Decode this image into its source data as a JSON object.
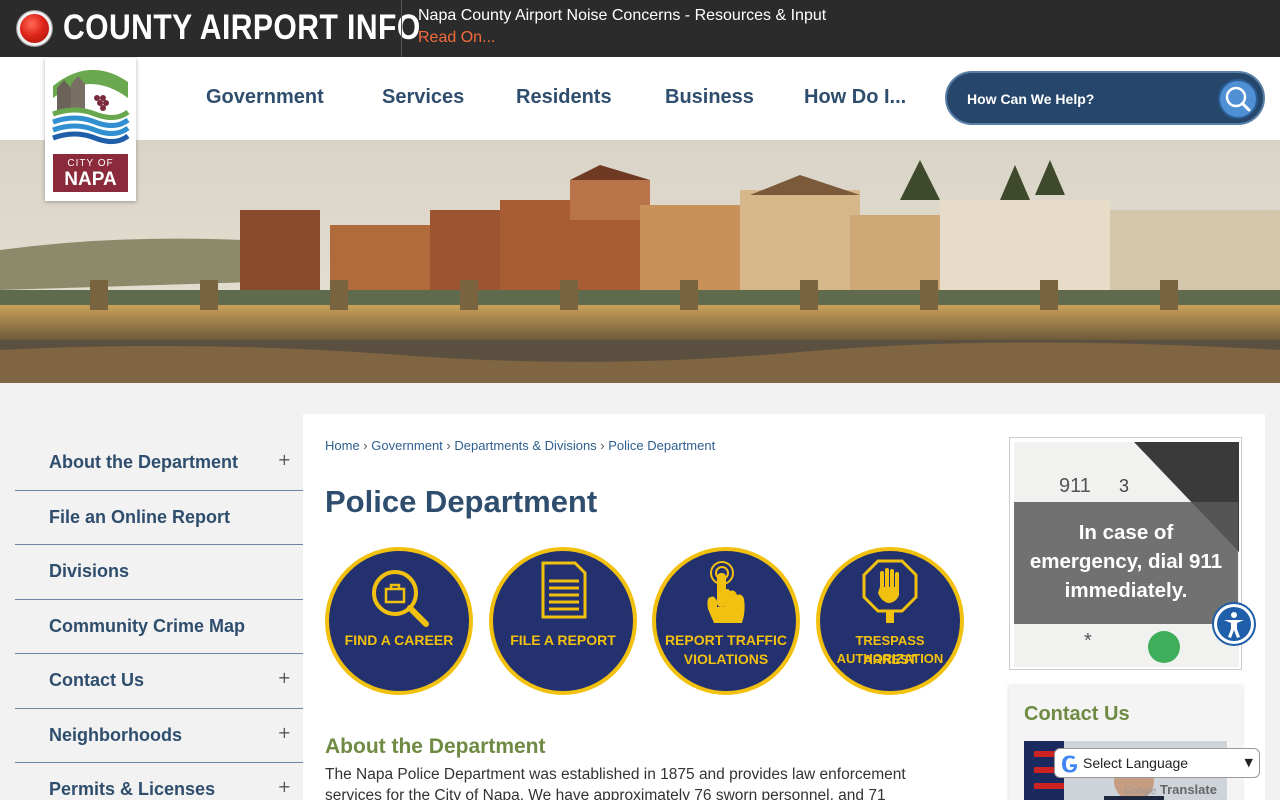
{
  "alert": {
    "title": "COUNTY AIRPORT INFO",
    "headline": "Napa County Airport Noise Concerns - Resources & Input",
    "link": "Read On..."
  },
  "logo": {
    "line1": "CITY OF",
    "line2": "NAPA"
  },
  "nav": {
    "items": [
      "Government",
      "Services",
      "Residents",
      "Business",
      "How Do I..."
    ]
  },
  "search": {
    "placeholder": "How Can We Help?"
  },
  "sidebar": {
    "items": [
      {
        "label": "About the Department",
        "expand": "+"
      },
      {
        "label": "File an Online Report",
        "expand": ""
      },
      {
        "label": "Divisions",
        "expand": ""
      },
      {
        "label": "Community Crime Map",
        "expand": ""
      },
      {
        "label": "Contact Us",
        "expand": "+"
      },
      {
        "label": "Neighborhoods",
        "expand": "+"
      },
      {
        "label": "Permits & Licenses",
        "expand": "+"
      }
    ]
  },
  "breadcrumb": [
    "Home",
    "Government",
    "Departments & Divisions",
    "Police Department"
  ],
  "page_title": "Police Department",
  "quick_links": [
    {
      "line1": "FIND A CAREER",
      "line2": "",
      "icon": "magnifier-briefcase-icon"
    },
    {
      "line1": "FILE A REPORT",
      "line2": "",
      "icon": "document-icon"
    },
    {
      "line1": "REPORT TRAFFIC",
      "line2": "VIOLATIONS",
      "icon": "hand-tap-icon"
    },
    {
      "line1": "TRESPASS ARREST",
      "line2": "AUTHORIZATION",
      "icon": "stop-hand-icon"
    }
  ],
  "about": {
    "heading": "About the Department",
    "text": "The Napa Police Department was established in 1875 and provides law enforcement services for the City of Napa. We have approximately 76 sworn personnel, and 71"
  },
  "emergency": {
    "line1": "In case of",
    "line2": "emergency, dial 911",
    "line3": "immediately."
  },
  "contact": {
    "heading": "Contact Us"
  },
  "translate": {
    "label": "Select Language",
    "powered_by": "Google",
    "translate_word": "Translate"
  },
  "colors": {
    "navy": "#23316e",
    "gold": "#f2c10f",
    "nav_text": "#2f4e6e",
    "green_heading": "#6e8a43",
    "alert_link": "#f26b3a"
  }
}
